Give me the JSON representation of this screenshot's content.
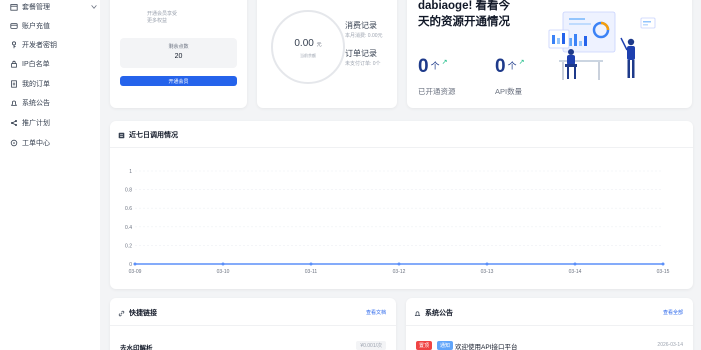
{
  "sidebar": {
    "items": [
      {
        "label": "套餐管理",
        "icon": "package-icon"
      },
      {
        "label": "账户充值",
        "icon": "wallet-icon"
      },
      {
        "label": "开发者密钥",
        "icon": "key-icon"
      },
      {
        "label": "IP白名单",
        "icon": "lock-icon"
      },
      {
        "label": "我的订单",
        "icon": "document-icon"
      },
      {
        "label": "系统公告",
        "icon": "bell-icon"
      },
      {
        "label": "推广计划",
        "icon": "share-icon"
      },
      {
        "label": "工单中心",
        "icon": "headset-icon"
      }
    ]
  },
  "account": {
    "line1": "开通会员享受",
    "line2": "更多权益",
    "balance_label": "剩余点数",
    "balance_value": "20",
    "button_label": "开通会员"
  },
  "consumption": {
    "amount": "0.00",
    "unit": "元",
    "amount_label": "当前余额",
    "record_title": "消费记录",
    "record_sub": "本月消费: 0.00元",
    "order_title": "订单记录",
    "order_sub": "未支付订单: 0个"
  },
  "welcome": {
    "title": "dabiaoge! 看看今天的资源开通情况",
    "stats": [
      {
        "value": "0",
        "unit": "个",
        "label": "已开通资源"
      },
      {
        "value": "0",
        "unit": "个",
        "label": "API数量"
      }
    ],
    "trend_arrow": "↗"
  },
  "chart_card": {
    "title": "近七日调用情况"
  },
  "chart_data": {
    "type": "line",
    "categories": [
      "03-09",
      "03-10",
      "03-11",
      "03-12",
      "03-13",
      "03-14",
      "03-15"
    ],
    "values": [
      0,
      0,
      0,
      0,
      0,
      0,
      0
    ],
    "yticks": [
      "0",
      "0.2",
      "0.4",
      "0.6",
      "0.8",
      "1"
    ],
    "ylim": [
      0,
      1
    ],
    "grid": true,
    "color": "#5b8ff9"
  },
  "quick_links": {
    "title": "快捷链接",
    "link": "查看文档",
    "item": "去水印解析",
    "price": "¥0.001/次"
  },
  "notice": {
    "title": "系统公告",
    "link": "查看全部",
    "tag1": "置顶",
    "tag2": "通知",
    "text": "欢迎使用API接口平台",
    "date": "2026-03-14"
  },
  "colors": {
    "accent": "#2563eb",
    "stat": "#1e3a8a",
    "trend": "#10b981",
    "line": "#5b8ff9",
    "danger": "#ef4444"
  }
}
